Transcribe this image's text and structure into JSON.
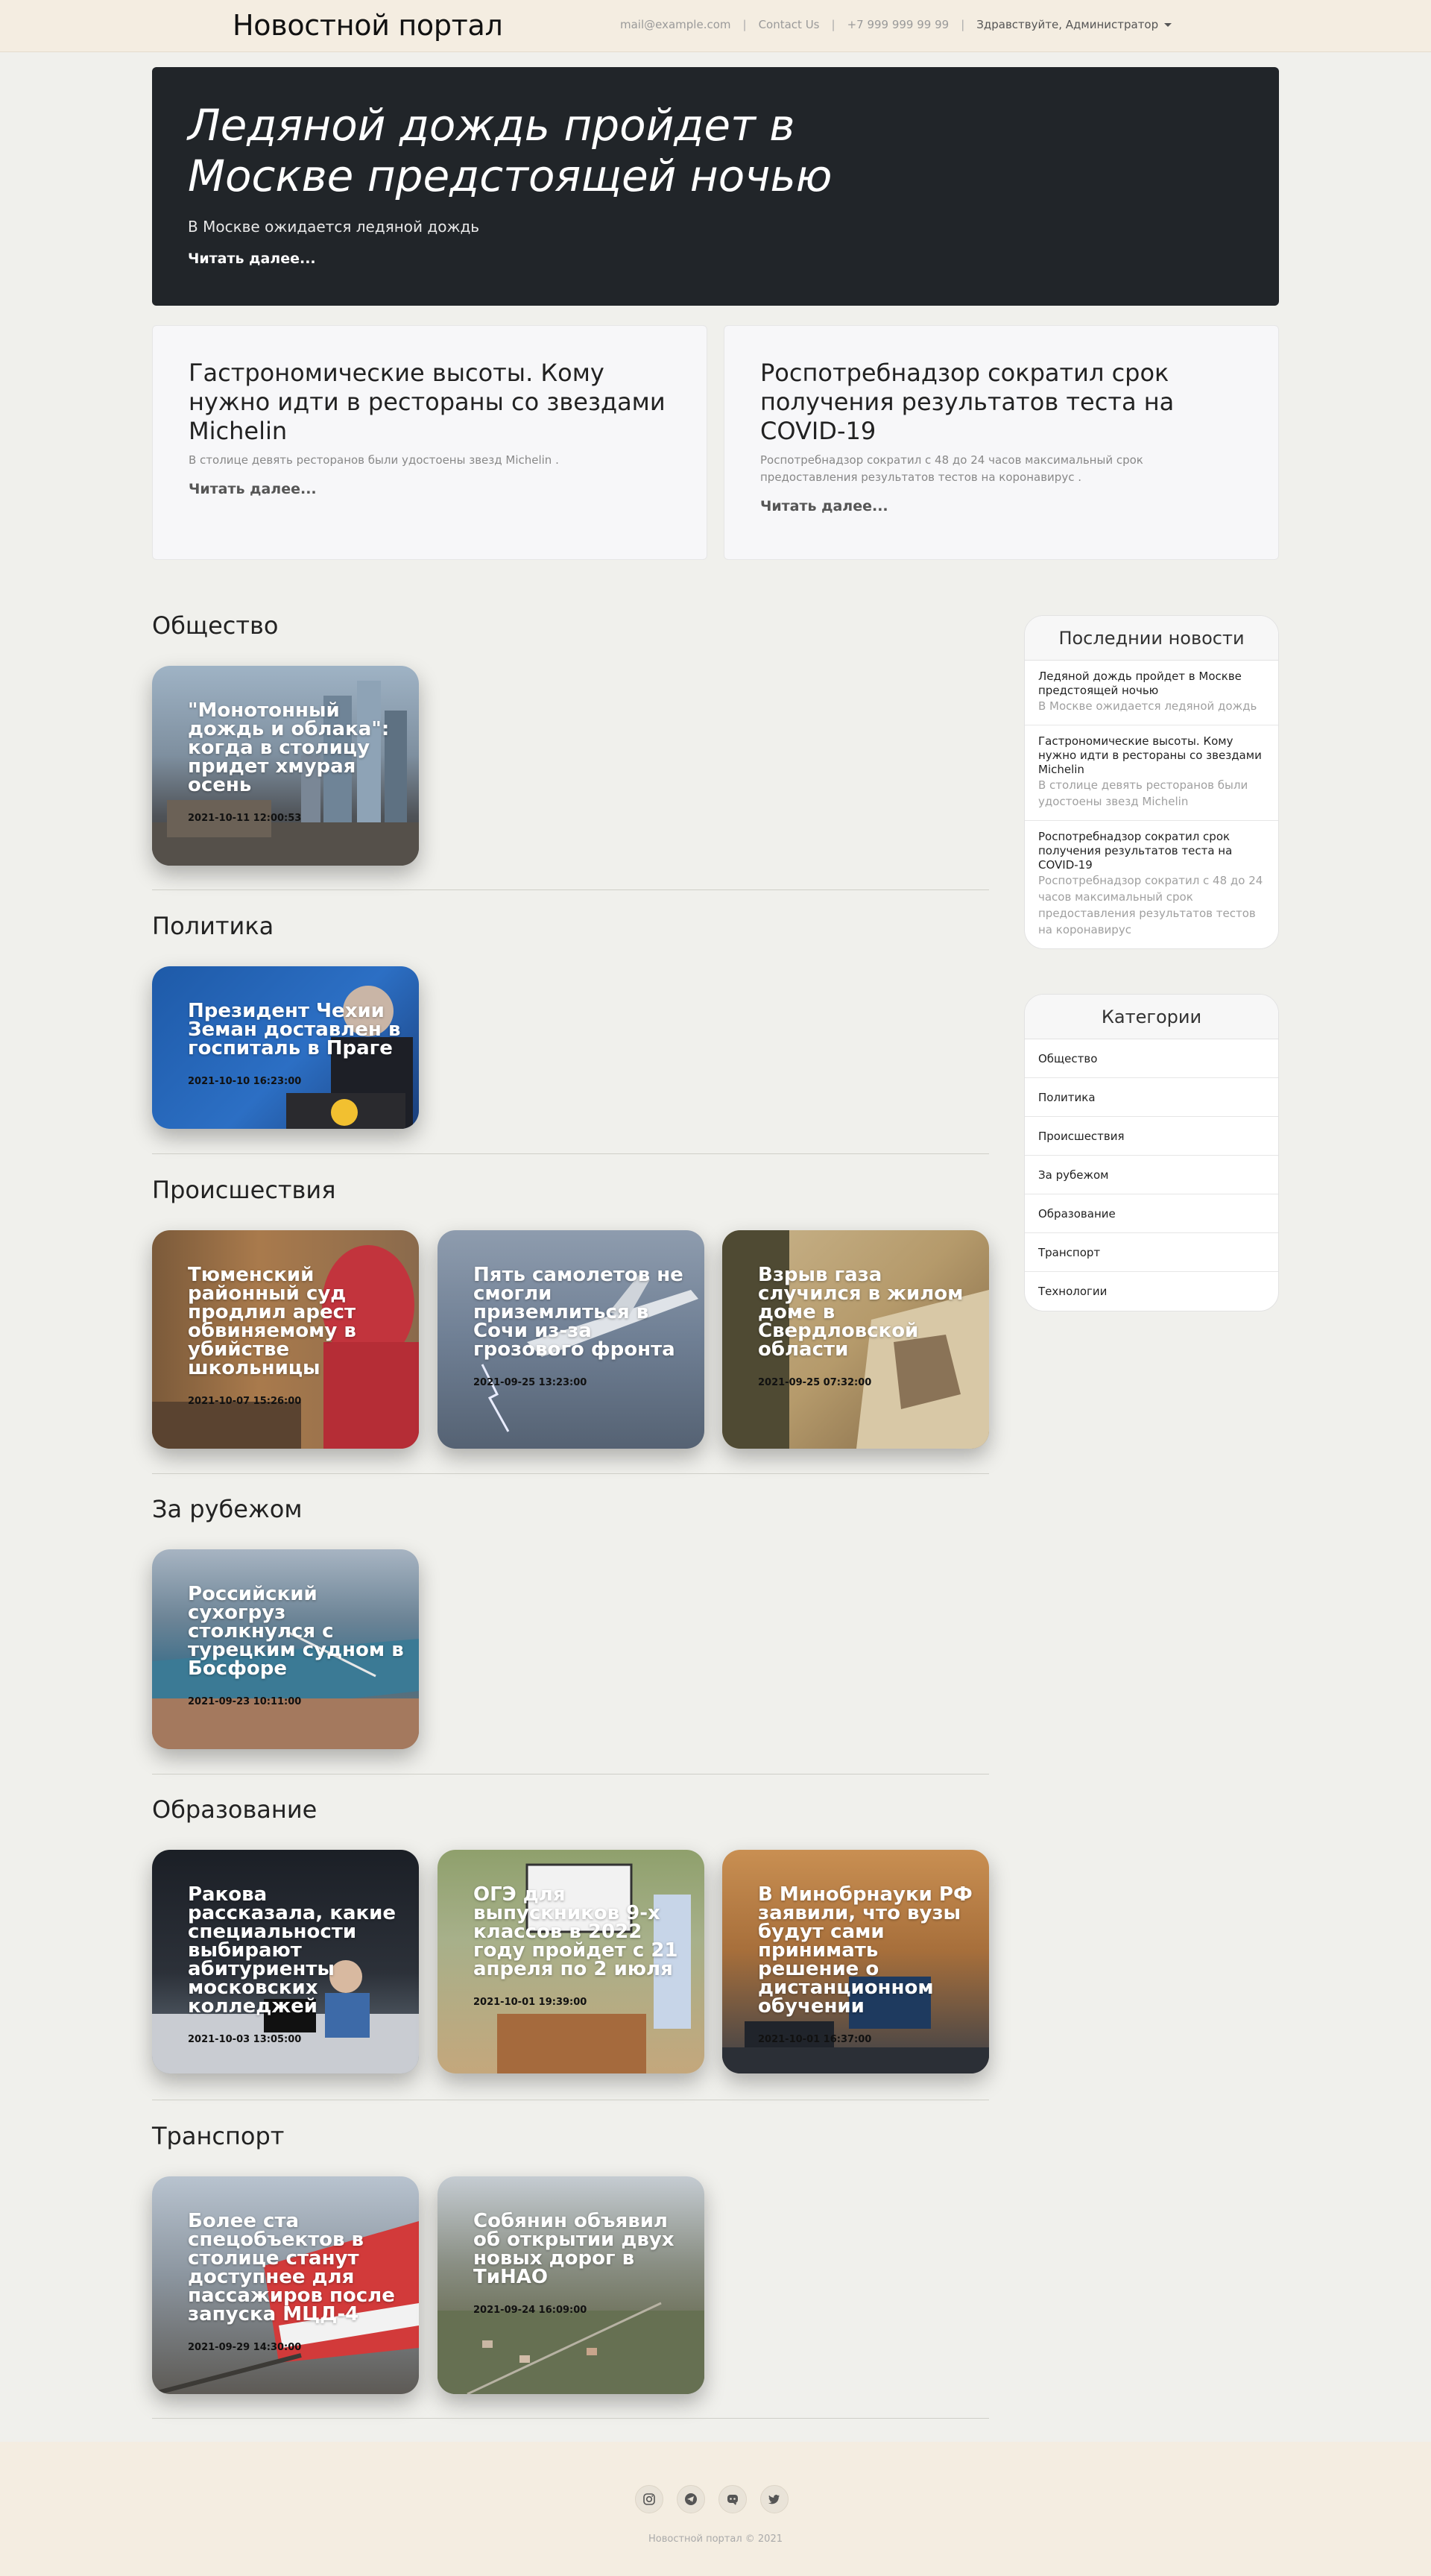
{
  "header": {
    "brand": "Новостной портал",
    "email": "mail@example.com",
    "contact": "Contact Us",
    "phone": "+7 999 999 99 99",
    "user": "Здравствуйте, Администратор"
  },
  "hero": {
    "title": "Ледяной дождь пройдет в Москве предстоящей ночью",
    "lead": "В Москве ожидается ледяной дождь",
    "more": "Читать далее..."
  },
  "featured": [
    {
      "title": "Гастрономические высоты. Кому нужно идти в рестораны со звездами Michelin",
      "lead": "В столице девять ресторанов были удостоены звезд Michelin .",
      "more": "Читать далее..."
    },
    {
      "title": "Роспотребнадзор сократил срок получения результатов теста на COVID-19",
      "lead": "Роспотребнадзор сократил с 48 до 24 часов максимальный срок предоставления результатов тестов на коронавирус .",
      "more": "Читать далее..."
    }
  ],
  "sections": [
    {
      "title": "Общество",
      "cards": [
        {
          "title": "\"Монотонный дождь и облака\": когда в столицу придет хмурая осень",
          "date": "2021-10-11 12:00:53",
          "image": "moscow-city-skyline"
        }
      ]
    },
    {
      "title": "Политика",
      "cards": [
        {
          "title": "Президент Чехии Земан доставлен в госпиталь в Праге",
          "date": "2021-10-10 16:23:00",
          "image": "president-at-podium"
        }
      ]
    },
    {
      "title": "Происшествия",
      "cards": [
        {
          "title": "Тюменский районный суд продлил арест обвиняемому в убийстве школьницы",
          "date": "2021-10-07 15:26:00",
          "image": "person-red-hood"
        },
        {
          "title": "Пять самолетов не смогли приземлиться в Сочи из-за грозового фронта",
          "date": "2021-09-25 13:23:00",
          "image": "plane-in-storm"
        },
        {
          "title": "Взрыв газа случился в жилом доме в Свердловской области",
          "date": "2021-09-25 07:32:00",
          "image": "rescuer-ruins"
        }
      ]
    },
    {
      "title": "За рубежом",
      "cards": [
        {
          "title": "Российский сухогруз столкнулся с турецким судном в Босфоре",
          "date": "2021-09-23 10:11:00",
          "image": "bosphorus-aerial"
        }
      ]
    },
    {
      "title": "Образование",
      "cards": [
        {
          "title": "Ракова рассказала, какие специальности выбирают абитуриенты московских колледжей",
          "date": "2021-10-03 13:05:00",
          "image": "computer-class"
        },
        {
          "title": "ОГЭ для выпускников 9-х классов в 2022 году пройдет с 21 апреля по 2 июля",
          "date": "2021-10-01 19:39:00",
          "image": "classroom-board"
        },
        {
          "title": "В Минобрнауки РФ заявили, что вузы будут сами принимать решение о дистанционном обучении",
          "date": "2021-10-01 16:37:00",
          "image": "lecture-hall"
        }
      ]
    },
    {
      "title": "Транспорт",
      "cards": [
        {
          "title": "Более ста спецобъектов в столице станут доступнее для пассажиров после запуска МЦД-4",
          "date": "2021-09-29 14:30:00",
          "image": "red-train"
        },
        {
          "title": "Собянин объявил об открытии двух новых дорог в ТиНАО",
          "date": "2021-09-24 16:09:00",
          "image": "aerial-suburb"
        }
      ]
    }
  ],
  "latest": {
    "title": "Последнии новости",
    "items": [
      {
        "title": "Ледяной дождь пройдет в Москве предстоящей ночью",
        "desc": "В Москве ожидается ледяной дождь"
      },
      {
        "title": "Гастрономические высоты. Кому нужно идти в рестораны со звездами Michelin",
        "desc": "В столице девять ресторанов были удостоены звезд Michelin"
      },
      {
        "title": "Роспотребнадзор сократил срок получения результатов теста на COVID-19",
        "desc": "Роспотребнадзор сократил с 48 до 24 часов максимальный срок предоставления результатов тестов на коронавирус"
      }
    ]
  },
  "categories": {
    "title": "Категории",
    "items": [
      "Общество",
      "Политика",
      "Происшествия",
      "За рубежом",
      "Образование",
      "Транспорт",
      "Технологии"
    ]
  },
  "footer": {
    "socials": [
      "instagram-icon",
      "telegram-icon",
      "discord-icon",
      "twitter-icon"
    ],
    "copyright": "Новостной портал © 2021"
  }
}
